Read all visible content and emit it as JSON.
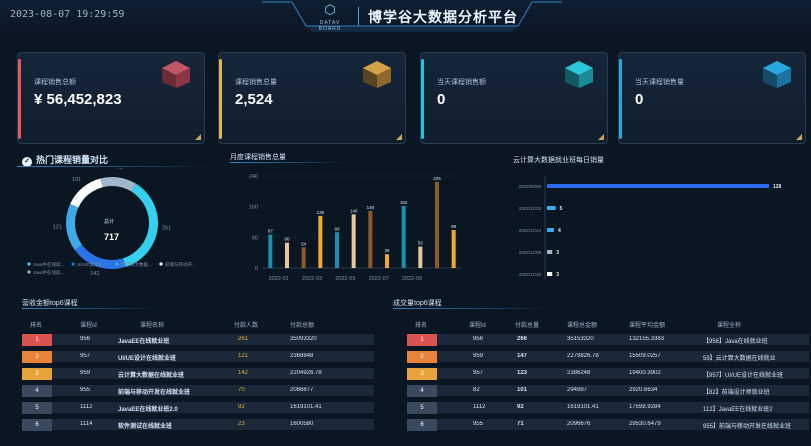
{
  "header": {
    "datetime": "2023-08-07 19:29:59",
    "logo_text": "DATAV BOARD",
    "title": "博学谷大数据分析平台"
  },
  "cards": [
    {
      "label": "课程销售总额",
      "value": "¥ 56,452,823",
      "accent": "#e25a5a"
    },
    {
      "label": "课程销售总量",
      "value": "2,524",
      "accent": "#e1b54a"
    },
    {
      "label": "当天课程销售额",
      "value": "0",
      "accent": "#20c7d8"
    },
    {
      "label": "当天课程销售量",
      "value": "0",
      "accent": "#2aa7e0"
    }
  ],
  "hot_courses": {
    "title": "热门课程销量对比",
    "center_label": "总计",
    "center_value": "717",
    "legend": [
      "Java中在线就...",
      "UI/UE设计在...",
      "云计算大数据...",
      "前端与移动开...",
      "Java中在线就..."
    ]
  },
  "chart_data": [
    {
      "type": "pie",
      "title": "热门课程销量对比",
      "labels": [
        "261",
        "142",
        "121",
        "101",
        "92"
      ],
      "values": [
        261,
        142,
        121,
        101,
        92
      ],
      "colors": [
        "#35d0ee",
        "#2a74e6",
        "#3fa8e6",
        "#ffffff",
        "#9fb8cc"
      ],
      "legend": [
        "Java中在线就...",
        "UI/UE设计在...",
        "云计算大数据...",
        "前端与移动开...",
        "Java中在线就..."
      ]
    },
    {
      "type": "bar",
      "title": "月度课程销售总量",
      "categories": [
        "2022-01",
        "2022-02",
        "2022-03",
        "2022-04",
        "2022-05",
        "2022-06",
        "2022-07",
        "2022-08",
        "2022-09",
        "2022-10"
      ],
      "x_tick_labels": [
        "2022-01",
        "2022-03",
        "2022-05",
        "2022-07",
        "2022-09"
      ],
      "values": [
        87,
        66,
        54,
        136,
        93,
        140,
        36,
        162,
        56,
        99
      ],
      "extra_bars": [
        67,
        67,
        54,
        149,
        35,
        225
      ],
      "series": [
        {
          "values": [
            87,
            66,
            54,
            136,
            93,
            140,
            36,
            162,
            56,
            99
          ]
        }
      ],
      "ylim": [
        0,
        240
      ],
      "yticks": [
        0,
        80,
        160,
        240
      ]
    },
    {
      "type": "bar",
      "title": "云计算大数据就业班每日销量",
      "orientation": "horizontal",
      "categories": [
        "2023/08/09",
        "2022/11/25",
        "2022/11/24",
        "2022/11/09",
        "2022/11/16"
      ],
      "values": [
        128,
        5,
        4,
        3,
        3
      ]
    }
  ],
  "monthly": {
    "title": "月度课程销售总量",
    "yticks": [
      "240",
      "160",
      "80",
      "0"
    ],
    "xticks": [
      "2022-01",
      "2022-03",
      "2022-05",
      "2022-07",
      "2022-09"
    ],
    "bars": [
      {
        "v": 87,
        "c": "#1a8fb0"
      },
      {
        "v": 66,
        "c": "#e8c89a"
      },
      {
        "v": 54,
        "c": "#8b5a2b"
      },
      {
        "v": 136,
        "c": "#f0a830"
      },
      {
        "v": 93,
        "c": "#1a8fb0"
      },
      {
        "v": 140,
        "c": "#e8c89a"
      },
      {
        "v": 149,
        "c": "#8b5a2b"
      },
      {
        "v": 36,
        "c": "#f0a830"
      },
      {
        "v": 162,
        "c": "#1a8fb0"
      },
      {
        "v": 56,
        "c": "#e8c89a"
      },
      {
        "v": 225,
        "c": "#8b5a2b"
      },
      {
        "v": 99,
        "c": "#f0a830"
      }
    ]
  },
  "daily": {
    "title": "云计算大数据就业班每日销量",
    "rows": [
      {
        "date": "2023/08/09",
        "v": 128,
        "c": "#2b6cf0"
      },
      {
        "date": "2022/11/25",
        "v": 5,
        "c": "#3fa8e6"
      },
      {
        "date": "2022/11/24",
        "v": 4,
        "c": "#3fa8e6"
      },
      {
        "date": "2022/11/09",
        "v": 3,
        "c": "#9fb8cc"
      },
      {
        "date": "2022/11/16",
        "v": 3,
        "c": "#ffffff"
      }
    ]
  },
  "revenue_table": {
    "title": "营收金额top6课程",
    "headers": [
      "排名",
      "课程id",
      "课程名称",
      "付款人数",
      "付款总额"
    ],
    "rows": [
      {
        "rank": "1",
        "id": "956",
        "name": "JavaEE在线就业班",
        "count": "261",
        "total": "35093320",
        "color": "#d9534f"
      },
      {
        "rank": "2",
        "id": "957",
        "name": "UI/UE设计在线就业班",
        "count": "121",
        "total": "2368848",
        "color": "#e8833a"
      },
      {
        "rank": "3",
        "id": "959",
        "name": "云计算大数据在线就业班",
        "count": "142",
        "total": "2204926.78",
        "color": "#e8a33a"
      },
      {
        "rank": "4",
        "id": "955",
        "name": "前端与移动开发在线就业班",
        "count": "70",
        "total": "2086877",
        "color": "#3a4a5e"
      },
      {
        "rank": "5",
        "id": "1112",
        "name": "JavaEE在线就业班2.0",
        "count": "92",
        "total": "1619101.41",
        "color": "#3a4a5e"
      },
      {
        "rank": "6",
        "id": "1114",
        "name": "软件测试在线就业班",
        "count": "23",
        "total": "1600580",
        "color": "#3a4a5e"
      }
    ]
  },
  "volume_table": {
    "title": "成交量top6课程",
    "headers": [
      "排名",
      "课程id",
      "付款总量",
      "课程总金额",
      "课程平均金额",
      "课程全称"
    ],
    "rows": [
      {
        "rank": "1",
        "id": "956",
        "qty": "266",
        "total": "35153320",
        "avg": "132155.3383",
        "name": "【956】Java在线就业班",
        "color": "#d9534f"
      },
      {
        "rank": "2",
        "id": "959",
        "qty": "147",
        "total": "2279826.78",
        "avg": "15509.0257",
        "name": "59】云计算大数据在线就业",
        "color": "#e8833a"
      },
      {
        "rank": "3",
        "id": "957",
        "qty": "123",
        "total": "2386248",
        "avg": "19400.3902",
        "name": "【957】UI/UE设计在线就业班",
        "color": "#e8a33a"
      },
      {
        "rank": "4",
        "id": "82",
        "qty": "101",
        "total": "294987",
        "avg": "2920.6634",
        "name": "【82】前端设计师就业班",
        "color": "#3a4a5e"
      },
      {
        "rank": "5",
        "id": "1112",
        "qty": "92",
        "total": "1619101.41",
        "avg": "17598.9284",
        "name": "112】JavaEE在线就业班2",
        "color": "#3a4a5e"
      },
      {
        "rank": "6",
        "id": "955",
        "qty": "71",
        "total": "2096676",
        "avg": "29530.6479",
        "name": "955】前端与移动开发在线就业班",
        "color": "#3a4a5e"
      }
    ]
  }
}
